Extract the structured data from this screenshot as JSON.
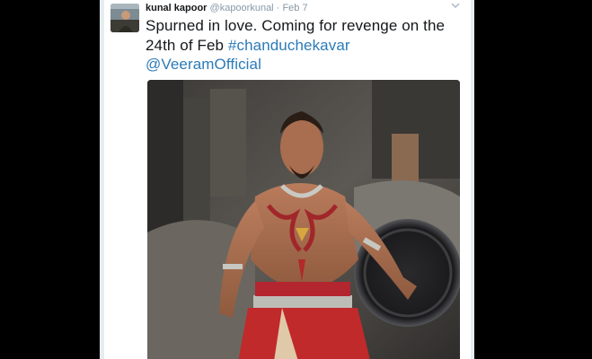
{
  "tweet": {
    "display_name": "kunal kapoor",
    "handle": "@kapoorkunal",
    "separator": "·",
    "date": "Feb 7",
    "text_plain": "Spurned in love. Coming for revenge on the 24th of Feb",
    "hashtag": "#chanduchekavar",
    "mention": "@VeeramOfficial",
    "link_color": "#2b7bb9"
  },
  "icons": {
    "caret": "chevron-down-icon"
  }
}
